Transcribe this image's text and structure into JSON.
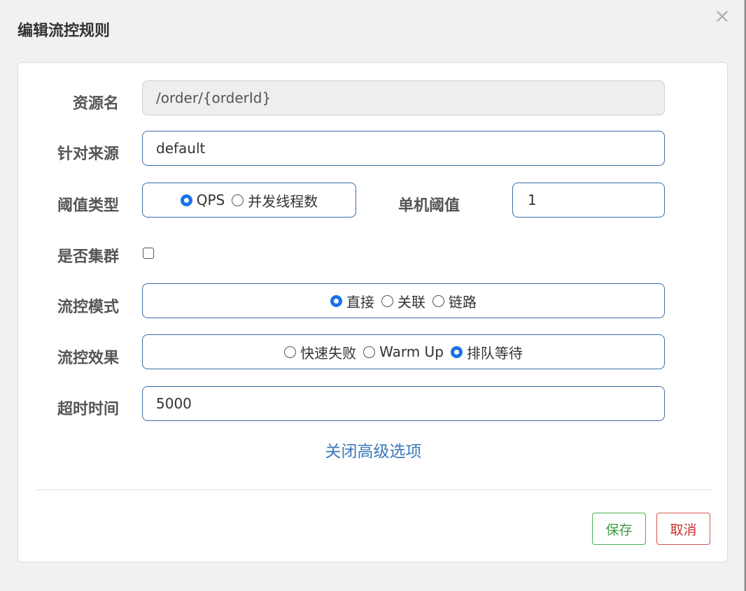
{
  "dialog": {
    "title": "编辑流控规则",
    "close_glyph": "×"
  },
  "form": {
    "resource_name": {
      "label": "资源名",
      "value": "/order/{orderId}"
    },
    "limit_app": {
      "label": "针对来源",
      "value": "default"
    },
    "grade": {
      "label": "阈值类型",
      "options": [
        {
          "label": "QPS",
          "checked": true
        },
        {
          "label": "并发线程数",
          "checked": false
        }
      ]
    },
    "threshold": {
      "label": "单机阈值",
      "value": "1"
    },
    "cluster": {
      "label": "是否集群",
      "checked": false
    },
    "strategy": {
      "label": "流控模式",
      "options": [
        {
          "label": "直接",
          "checked": true
        },
        {
          "label": "关联",
          "checked": false
        },
        {
          "label": "链路",
          "checked": false
        }
      ]
    },
    "control_behavior": {
      "label": "流控效果",
      "options": [
        {
          "label": "快速失败",
          "checked": false
        },
        {
          "label": "Warm Up",
          "checked": false
        },
        {
          "label": "排队等待",
          "checked": true
        }
      ]
    },
    "timeout": {
      "label": "超时时间",
      "value": "5000"
    },
    "advanced_toggle": "关闭高级选项"
  },
  "footer": {
    "save_label": "保存",
    "cancel_label": "取消"
  },
  "colors": {
    "accent": "#1a73e8",
    "field_border": "#3a6ea5",
    "save": "#4caf50",
    "cancel": "#d9534f",
    "link": "#3a7ab8"
  }
}
